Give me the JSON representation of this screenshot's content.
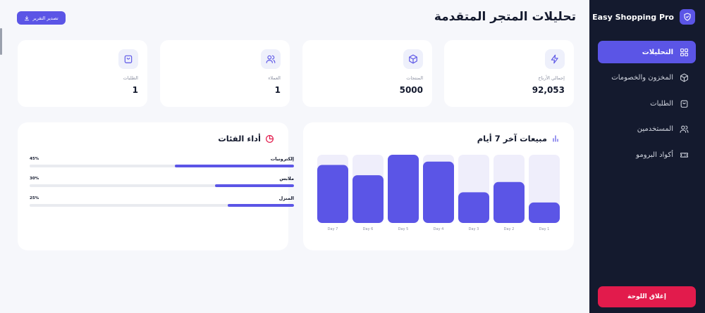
{
  "brand": {
    "name": "Easy Shopping Pro"
  },
  "nav": [
    {
      "label": "التحليلات",
      "icon": "dashboard-icon",
      "active": true
    },
    {
      "label": "المخزون والخصومات",
      "icon": "box-icon",
      "active": false
    },
    {
      "label": "الطلبات",
      "icon": "bag-icon",
      "active": false
    },
    {
      "label": "المستخدمين",
      "icon": "users-icon",
      "active": false
    },
    {
      "label": "أكواد البرومو",
      "icon": "ticket-icon",
      "active": false
    }
  ],
  "close_label": "إغلاق اللوحة",
  "header": {
    "title": "تحليلات المتجر المتقدمة",
    "export_label": "تصدير التقرير"
  },
  "stats": [
    {
      "label": "إجمالي الأرباح",
      "value": "92,053",
      "icon": "lightning-icon"
    },
    {
      "label": "المنتجات",
      "value": "5000",
      "icon": "box-icon"
    },
    {
      "label": "العملاء",
      "value": "1",
      "icon": "users-icon"
    },
    {
      "label": "الطلبات",
      "value": "1",
      "icon": "bag-icon"
    }
  ],
  "sales_panel": {
    "title": "مبيعات آخر 7 أيام",
    "icon": "bar-chart-icon"
  },
  "categories_panel": {
    "title": "أداء الفئات",
    "icon": "pie-chart-icon",
    "items": [
      {
        "name": "إلكترونيات",
        "percent_label": "45%",
        "percent": 45
      },
      {
        "name": "ملابس",
        "percent_label": "30%",
        "percent": 30
      },
      {
        "name": "المنزل",
        "percent_label": "25%",
        "percent": 25
      }
    ]
  },
  "colors": {
    "accent": "#5b55e6",
    "sidebar": "#141a2e",
    "danger": "#e21b4c",
    "bar_bg": "#efeefb"
  },
  "chart_data": {
    "type": "bar",
    "categories": [
      "Day 7",
      "Day 6",
      "Day 5",
      "Day 4",
      "Day 3",
      "Day 2",
      "Day 1"
    ],
    "values": [
      85,
      70,
      100,
      90,
      45,
      60,
      30
    ],
    "ylim": [
      0,
      100
    ],
    "grid": false
  }
}
